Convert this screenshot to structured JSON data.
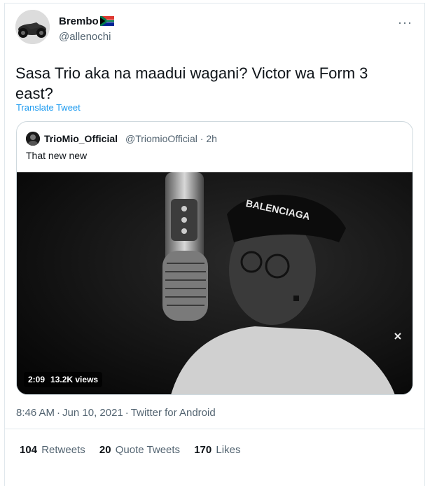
{
  "tweet": {
    "author_name": "Brembo",
    "author_handle": "@allenochi",
    "text": "Sasa Trio aka na maadui wagani? Victor wa Form 3 east?",
    "translate_label": "Translate Tweet",
    "more_icon": "more-icon",
    "flag_icon": "south-africa-flag-icon"
  },
  "quote": {
    "author_name": "TrioMio_Official",
    "author_handle": "@TriomioOfficial",
    "separator": "·",
    "time": "2h",
    "text": "That new new",
    "video": {
      "duration": "2:09",
      "views": "13.2K views",
      "cap_text": "BALENCIAGA"
    }
  },
  "meta": {
    "time": "8:46 AM",
    "sep1": "·",
    "date": "Jun 10, 2021",
    "sep2": "·",
    "source": "Twitter for Android"
  },
  "stats": {
    "retweets_count": "104",
    "retweets_label": "Retweets",
    "quotes_count": "20",
    "quotes_label": "Quote Tweets",
    "likes_count": "170",
    "likes_label": "Likes"
  },
  "colors": {
    "link": "#1d9bf0",
    "secondary_text": "#536471",
    "border": "#cfd9de"
  }
}
